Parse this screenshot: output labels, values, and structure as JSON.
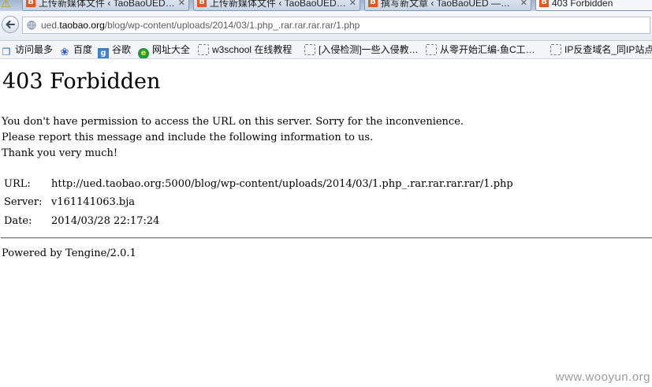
{
  "tabs": [
    {
      "title": "上传新媒体文件 ‹ TaoBaoUED…",
      "favicon": "wordpress-tab-icon"
    },
    {
      "title": "上传新媒体文件 ‹ TaoBaoUED…",
      "favicon": "wordpress-tab-icon"
    },
    {
      "title": "撰写新文章 ‹ TaoBaoUED —…",
      "favicon": "wordpress-tab-icon"
    },
    {
      "title": "403 Forbidden",
      "favicon": "wordpress-tab-icon"
    }
  ],
  "address_bar": {
    "url_prefix": "ued.",
    "url_host": "taobao.org",
    "url_path": "/blog/wp-content/uploads/2014/03/1.php_.rar.rar.rar.rar/1.php"
  },
  "bookmarks": [
    {
      "label": "访问最多",
      "icon": "sidebar-icon"
    },
    {
      "label": "百度",
      "icon": "baidu-paw-icon"
    },
    {
      "label": "谷歌",
      "icon": "google-icon"
    },
    {
      "label": "网址大全",
      "icon": "globe-green-icon"
    },
    {
      "label": "w3school 在线教程",
      "icon": "blank-page-icon"
    },
    {
      "label": "[入侵检测]一些入侵教…",
      "icon": "blank-page-icon"
    },
    {
      "label": "从零开始汇编-鱼C工…",
      "icon": "blank-page-icon"
    },
    {
      "label": "IP反查域名_同IP站点",
      "icon": "blank-page-icon"
    }
  ],
  "page": {
    "heading": "403 Forbidden",
    "message_lines": [
      "You don't have permission to access the URL on this server. Sorry for the inconvenience.",
      "Please report this message and include the following information to us.",
      "Thank you very much!"
    ],
    "info": [
      {
        "key": "URL:",
        "value": "http://ued.taobao.org:5000/blog/wp-content/uploads/2014/03/1.php_.rar.rar.rar.rar/1.php"
      },
      {
        "key": "Server:",
        "value": "v161141063.bja"
      },
      {
        "key": "Date:",
        "value": "2014/03/28 22:17:24"
      }
    ],
    "footer": "Powered by Tengine/2.0.1"
  },
  "watermark": "www.wooyun.org",
  "colors": {
    "favicon": "#e8541c",
    "text": "#000000",
    "url_gray": "#5d5d5d",
    "watermark": "#9c9c9c"
  }
}
